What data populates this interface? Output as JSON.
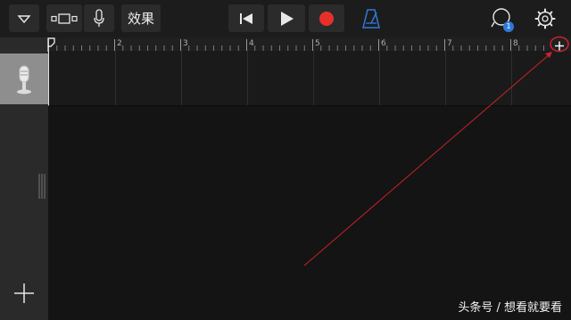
{
  "toolbar": {
    "fx_label": "效果",
    "badge_count": "1"
  },
  "ruler": {
    "bars": [
      "2",
      "3",
      "4",
      "5",
      "6",
      "7",
      "8"
    ]
  },
  "watermark": "头条号 / 想看就要看",
  "colors": {
    "record": "#e8302a",
    "metronome": "#2f7ad8",
    "badge": "#2f7ad8",
    "annotation": "#d0202a"
  }
}
